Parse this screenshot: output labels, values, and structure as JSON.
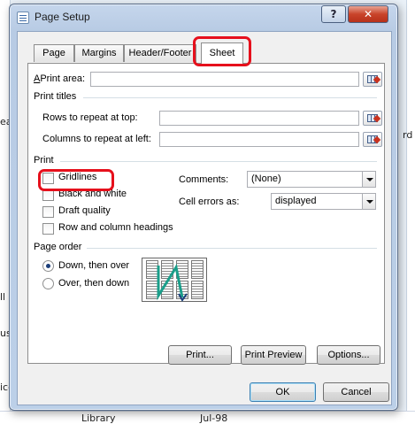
{
  "background": {
    "cells": [
      "eak",
      "ll s",
      "us i",
      "ice",
      "Library",
      "Jul-98",
      "rd"
    ]
  },
  "window": {
    "title": "Page Setup",
    "help_glyph": "?",
    "close_glyph": "✕"
  },
  "tabs": [
    {
      "label": "Page"
    },
    {
      "label": "Margins"
    },
    {
      "label": "Header/Footer"
    },
    {
      "label": "Sheet"
    }
  ],
  "sheet": {
    "print_area_label": "Print area:",
    "print_area_value": "",
    "print_titles_label": "Print titles",
    "rows_label": "Rows to repeat at top:",
    "rows_value": "",
    "cols_label": "Columns to repeat at left:",
    "cols_value": "",
    "print_label": "Print",
    "gridlines_label": "Gridlines",
    "black_white_label": "Black and white",
    "draft_label": "Draft quality",
    "row_col_headings_label": "Row and column headings",
    "comments_label": "Comments:",
    "comments_value": "(None)",
    "cell_errors_label": "Cell errors as:",
    "cell_errors_value": "displayed",
    "page_order_label": "Page order",
    "down_over_label": "Down, then over",
    "over_down_label": "Over, then down"
  },
  "buttons": {
    "print": "Print...",
    "print_preview": "Print Preview",
    "options": "Options...",
    "ok": "OK",
    "cancel": "Cancel"
  },
  "colors": {
    "highlight": "#e6101c",
    "arrow": "#1a9e8a"
  }
}
